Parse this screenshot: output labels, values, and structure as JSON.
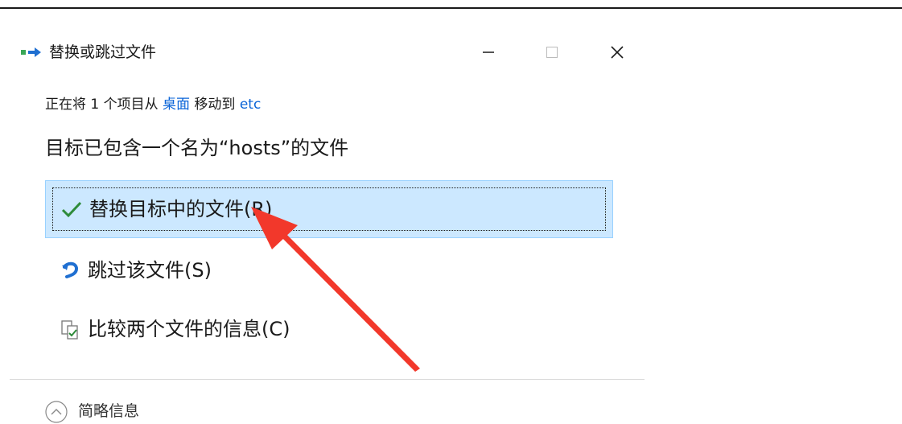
{
  "window": {
    "title": "替换或跳过文件",
    "controls": {
      "minimize": "minimize-icon",
      "maximize": "maximize-icon",
      "close": "close-icon"
    }
  },
  "progress": {
    "prefix": "正在将 1 个项目从 ",
    "source": "桌面",
    "middle": " 移动到 ",
    "destination": "etc"
  },
  "conflict_message": "目标已包含一个名为“hosts”的文件",
  "options": {
    "replace": "替换目标中的文件(R)",
    "skip": "跳过该文件(S)",
    "compare": "比较两个文件的信息(C)"
  },
  "details": {
    "label": "简略信息"
  },
  "colors": {
    "selected_bg": "#cce8ff",
    "selected_border": "#99d1ff",
    "link": "#0a64d8",
    "check": "#2e8b3a",
    "skip_icon": "#1f6fd1",
    "annotation_arrow": "#f2382b"
  },
  "icons": {
    "app": "file-move-icon",
    "replace": "checkmark-icon",
    "skip": "skip-arrow-icon",
    "compare": "compare-files-icon",
    "details": "chevron-up-circle-icon"
  }
}
